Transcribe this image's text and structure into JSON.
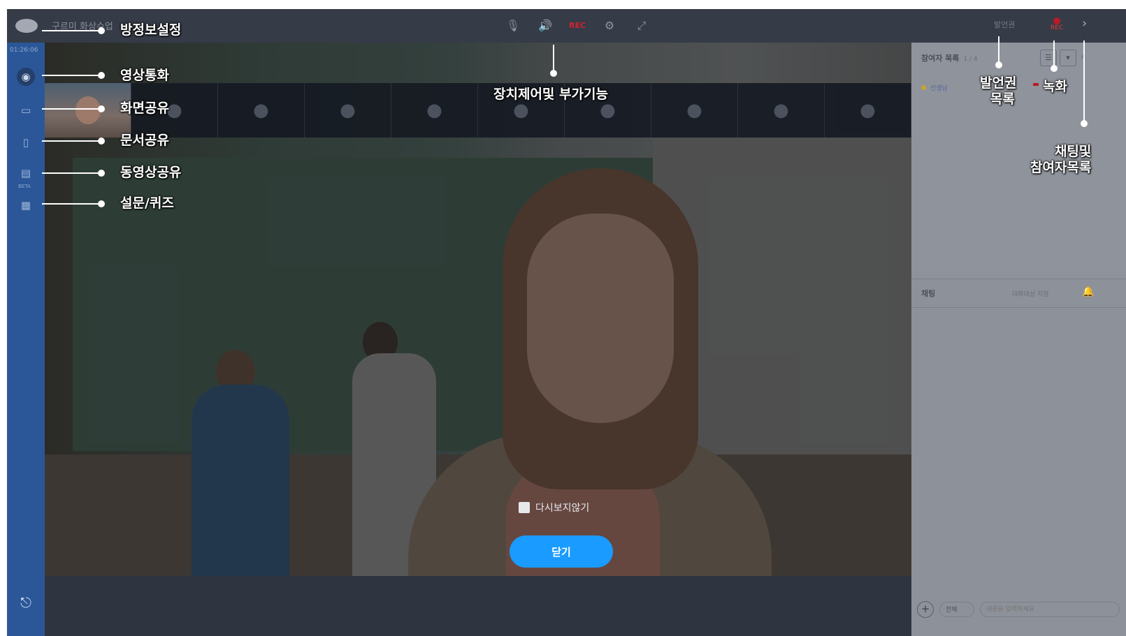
{
  "room": {
    "title": "구르미 화상수업",
    "timer": "01:26:06"
  },
  "toolbar": {
    "controls": [
      {
        "name": "mic-icon",
        "glyph": "🎙"
      },
      {
        "name": "speaker-icon",
        "glyph": "🔊"
      },
      {
        "name": "rec-indicator-icon",
        "glyph": "REC"
      },
      {
        "name": "settings-icon",
        "glyph": "⚙"
      },
      {
        "name": "fullscreen-icon",
        "glyph": "⤢"
      }
    ],
    "speaker_label": "발언권",
    "rec_label": "REC"
  },
  "rail": {
    "beta": "BETA",
    "exit_glyph": "⎋"
  },
  "overlay": {
    "dont_show_again": "다시보지않기",
    "close": "닫기"
  },
  "participants_panel": {
    "title": "참여자 목록",
    "count": "1 / 4",
    "entry_name": "선생님"
  },
  "chat": {
    "title": "채팅",
    "target": "대화대상 지정",
    "select": "전체",
    "placeholder": "내용을 입력하세요"
  },
  "callouts": {
    "room_info": "방정보설정",
    "video_call": "영상통화",
    "screen_share": "화면공유",
    "doc_share": "문서공유",
    "video_share": "동영상공유",
    "survey_quiz": "설문/퀴즈",
    "device_control": "장치제어및 부가기능",
    "speaker_list_1": "발언권",
    "speaker_list_2": "목록",
    "recording": "녹화",
    "chat_list_1": "채팅및",
    "chat_list_2": "참여자목록"
  },
  "colors": {
    "accent": "#1a9bff",
    "rail": "#2b5798",
    "rec": "#d3232f"
  }
}
